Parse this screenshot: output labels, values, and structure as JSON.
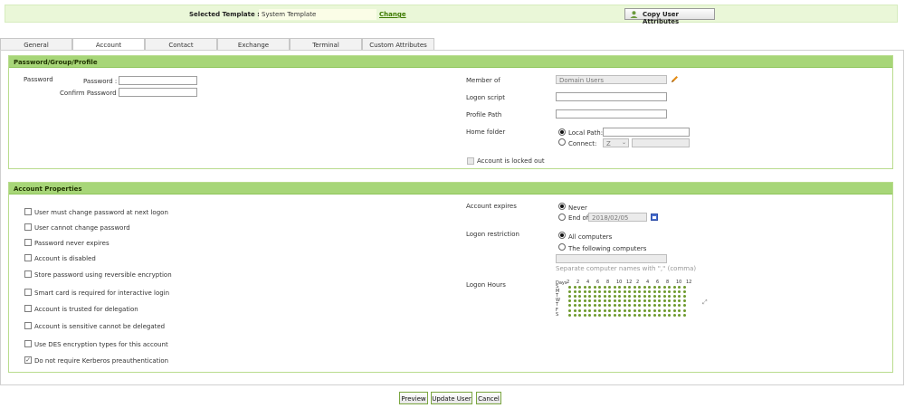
{
  "header": {
    "selected_template_label": "Selected Template :",
    "selected_template_value": "System Template",
    "change_link": "Change",
    "copy_button": "Copy User Attributes"
  },
  "tabs": [
    {
      "label": "General",
      "active": false
    },
    {
      "label": "Account",
      "active": true
    },
    {
      "label": "Contact",
      "active": false
    },
    {
      "label": "Exchange",
      "active": false
    },
    {
      "label": "Terminal",
      "active": false
    },
    {
      "label": "Custom Attributes",
      "active": false
    }
  ],
  "profile": {
    "title": "Password/Group/Profile",
    "password_section_label": "Password",
    "password_label": "Password :",
    "confirm_password_label": "Confirm Password :",
    "member_of_label": "Member of",
    "member_of_value": "Domain Users",
    "logon_script_label": "Logon script",
    "profile_path_label": "Profile Path",
    "home_folder_label": "Home folder",
    "local_path_label": "Local Path:",
    "connect_label": "Connect:",
    "connect_drive": "Z",
    "account_locked_label": "Account is locked out"
  },
  "properties": {
    "title": "Account Properties",
    "options": [
      {
        "label": "User must change password at next logon",
        "checked": false
      },
      {
        "label": "User cannot change password",
        "checked": false
      },
      {
        "label": "Password never expires",
        "checked": false
      },
      {
        "label": "Account is disabled",
        "checked": false
      },
      {
        "label": "Store password using reversible encryption",
        "checked": false
      },
      {
        "label": "Smart card is required for interactive login",
        "checked": false
      },
      {
        "label": "Account is trusted for delegation",
        "checked": false
      },
      {
        "label": "Account is sensitive cannot be delegated",
        "checked": false
      },
      {
        "label": "Use DES encryption types for this account",
        "checked": false
      },
      {
        "label": "Do not require Kerberos preauthentication",
        "checked": true
      }
    ],
    "account_expires_label": "Account expires",
    "never_label": "Never",
    "end_of_label": "End of",
    "end_of_date": "2018/02/05",
    "logon_restriction_label": "Logon restriction",
    "all_computers_label": "All computers",
    "following_computers_label": "The following computers",
    "separate_hint": "Separate computer names with \",\" (comma)",
    "logon_hours_label": "Logon Hours",
    "logon_hours_days_label": "Days",
    "logon_hours_hour_labels": [
      "2",
      "2",
      "4",
      "6",
      "8",
      "10",
      "12",
      "2",
      "4",
      "6",
      "8",
      "10",
      "12"
    ],
    "logon_hours_days": [
      "S",
      "M",
      "T",
      "W",
      "T",
      "F",
      "S"
    ]
  },
  "footer": {
    "preview": "Preview",
    "update_user": "Update User",
    "cancel": "Cancel"
  },
  "colors": {
    "section_header": "#a7d678",
    "topbar": "#eaf7d8",
    "dots": "#6e9a2c",
    "link": "#3d7a00"
  }
}
